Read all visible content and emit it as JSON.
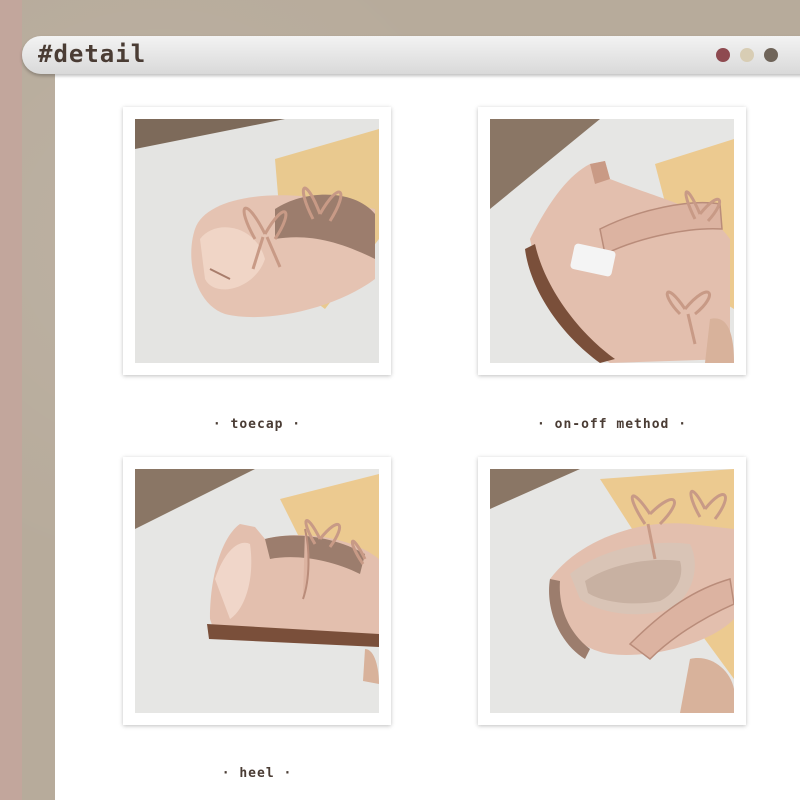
{
  "header": {
    "title": "#detail",
    "dots": [
      "#8e4a50",
      "#d8cdb4",
      "#6f6459"
    ]
  },
  "photos": [
    {
      "caption": "· toecap ·",
      "subject": "shoe toecap with bow"
    },
    {
      "caption": "· on-off method ·",
      "subject": "shoe hook-and-loop strap"
    },
    {
      "caption": "· heel ·",
      "subject": "shoe heel"
    },
    {
      "caption": "",
      "subject": "shoe insole"
    }
  ],
  "colors": {
    "leather": "#e3bfae",
    "leather_shadow": "#b98c7a",
    "sole": "#7a4f3a",
    "text": "#4a3c34"
  }
}
